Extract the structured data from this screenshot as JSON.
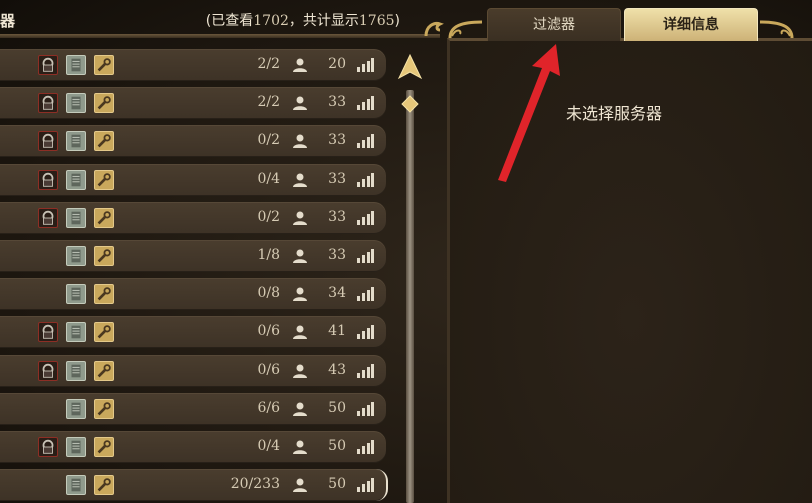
{
  "header": {
    "title": "器",
    "count_prefix": "(已查看",
    "viewed": "1702",
    "count_middle": "，共计显示",
    "total": "1765",
    "count_suffix": ")"
  },
  "tabs": {
    "filter": "过滤器",
    "details": "详细信息",
    "active": "details"
  },
  "details": {
    "empty_text": "未选择服务器"
  },
  "servers": [
    {
      "locked": true,
      "players": "2/2",
      "ping": "20"
    },
    {
      "locked": true,
      "players": "2/2",
      "ping": "33"
    },
    {
      "locked": true,
      "players": "0/2",
      "ping": "33"
    },
    {
      "locked": true,
      "players": "0/4",
      "ping": "33"
    },
    {
      "locked": true,
      "players": "0/2",
      "ping": "33"
    },
    {
      "locked": false,
      "players": "1/8",
      "ping": "33"
    },
    {
      "locked": false,
      "players": "0/8",
      "ping": "34"
    },
    {
      "locked": true,
      "players": "0/6",
      "ping": "41"
    },
    {
      "locked": true,
      "players": "0/6",
      "ping": "43"
    },
    {
      "locked": false,
      "players": "6/6",
      "ping": "50"
    },
    {
      "locked": true,
      "players": "0/4",
      "ping": "50"
    },
    {
      "locked": false,
      "players": "20/233",
      "ping": "50",
      "selected": true
    }
  ],
  "colors": {
    "accent_gold": "#e6c77a",
    "arrow_red": "#e0242a"
  }
}
